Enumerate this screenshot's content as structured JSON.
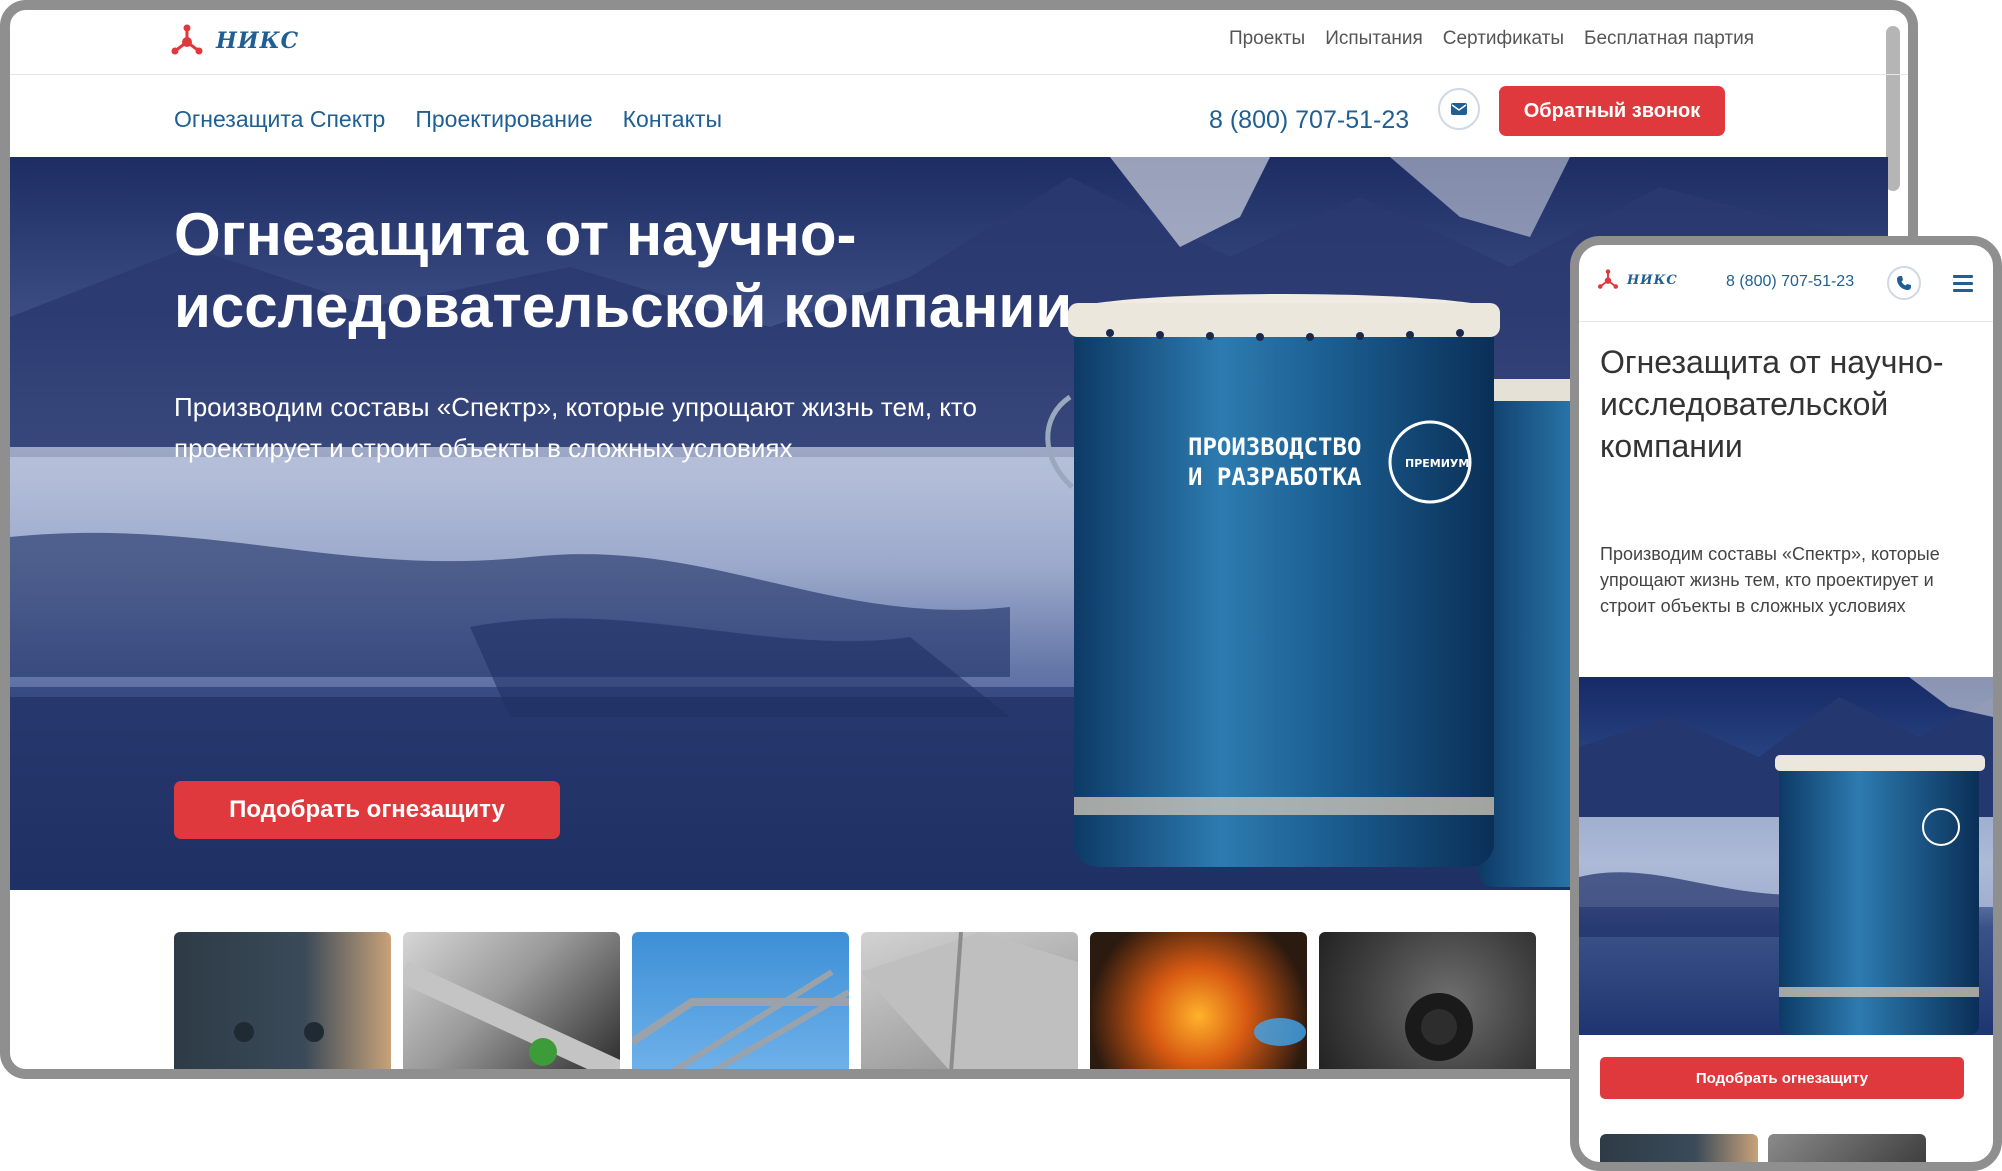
{
  "brand": {
    "name": "НИКС"
  },
  "desktop": {
    "top_links": [
      "Проекты",
      "Испытания",
      "Сертификаты",
      "Бесплатная партия"
    ],
    "nav_links": [
      "Огнезащита Спектр",
      "Проектирование",
      "Контакты"
    ],
    "phone": "8 (800) 707-51-23",
    "mail_icon": "mail-icon",
    "callback_label": "Обратный звонок",
    "hero": {
      "title": "Огнезащита от научно-исследовательской компании",
      "subtitle": "Производим составы «Спектр», которые упрощают жизнь тем, кто проектирует и строит объекты в сложных условиях",
      "cta": "Подобрать огнезащиту",
      "can_text": {
        "line1": "ПРОИЗВОДСТВО",
        "line2": "И РАЗРАБОТКА",
        "badge": "ПРЕМИУМ"
      }
    },
    "thumbnails": [
      "steel-column",
      "sprinkler-pipe",
      "steel-frame-sky",
      "air-duct",
      "fire-sparks",
      "mesh-roll"
    ]
  },
  "mobile": {
    "phone": "8 (800) 707-51-23",
    "phone_icon": "phone-icon",
    "menu_icon": "hamburger-icon",
    "title": "Огнезащита от научно-исследовательской компании",
    "subtitle": "Производим составы «Спектр», которые упрощают жизнь тем, кто проектирует и строит объекты в сложных условиях",
    "cta": "Подобрать огнезащиту"
  },
  "colors": {
    "brand_blue": "#1f5f93",
    "accent_red": "#df393d"
  }
}
